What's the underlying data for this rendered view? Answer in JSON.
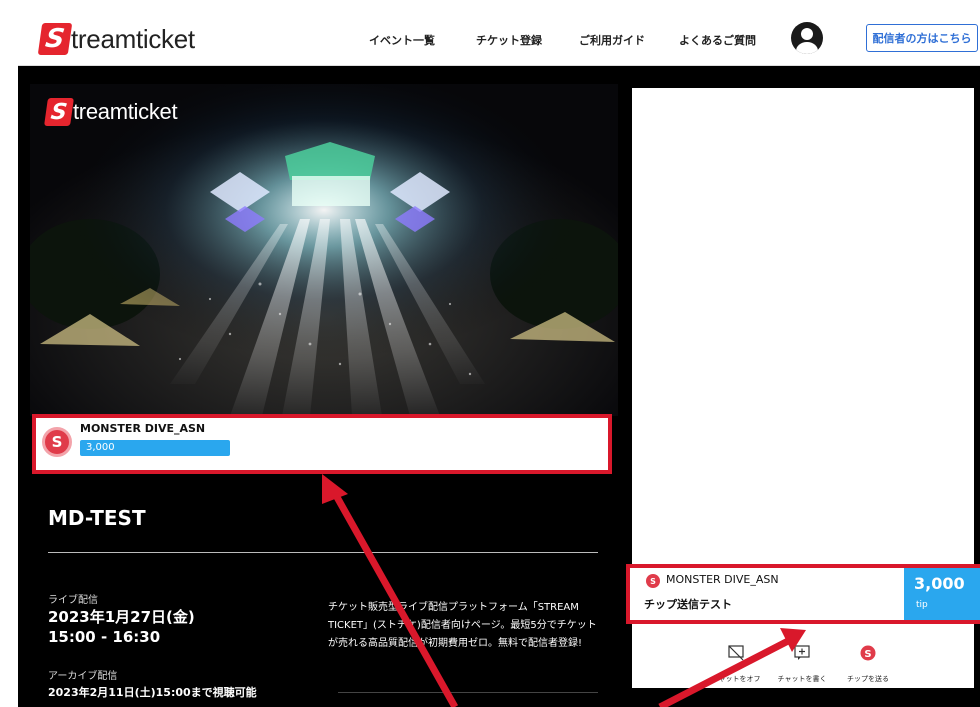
{
  "header": {
    "logo_letter": "S",
    "logo_text": "treamticket",
    "nav": [
      "イベント一覧",
      "チケット登録",
      "ご利用ガイド",
      "よくあるご質問"
    ],
    "streamer_button": "配信者の方はこちら"
  },
  "video": {
    "overlay_logo_letter": "S",
    "overlay_logo_text": "treamticket"
  },
  "tip_overlay": {
    "icon_letter": "S",
    "name": "MONSTER DIVE_ASN",
    "amount": "3,000"
  },
  "event": {
    "title": "MD-TEST",
    "live_label": "ライブ配信",
    "live_date": "2023年1月27日(金)",
    "live_time": "15:00 - 16:30",
    "archive_label": "アーカイブ配信",
    "archive_until": "2023年2月11日(土)15:00まで視聴可能",
    "description": "チケット販売型ライブ配信プラットフォーム「STREAM TICKET」(ストチケ)配信者向けページ。最短5分でチケットが売れる高品質配信が初期費用ゼロ。無料で配信者登録!"
  },
  "chat": {
    "tip_icon_letter": "S",
    "tip_name": "MONSTER DIVE_ASN",
    "tip_message": "チップ送信テスト",
    "tip_amount": "3,000",
    "tip_unit": "tip",
    "actions": [
      "チャットをオフ",
      "チャットを書く",
      "チップを送る"
    ]
  },
  "colors": {
    "brand_red": "#e5252e",
    "highlight_red": "#d9182b",
    "tip_blue": "#2aa7ee",
    "link_blue": "#2f6fd6"
  }
}
